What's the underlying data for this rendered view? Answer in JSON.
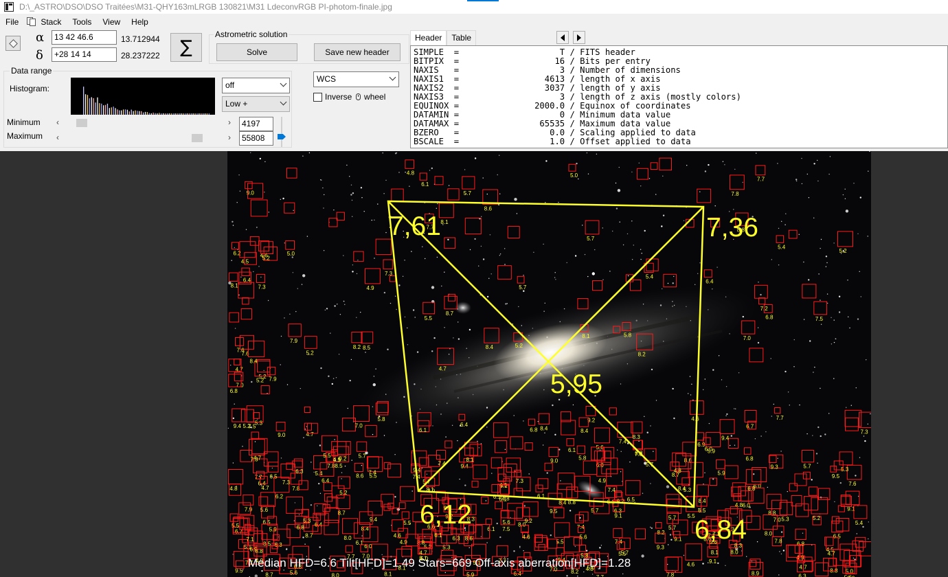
{
  "window": {
    "title": "D:\\_ASTRO\\DSO\\DSO Traitées\\M31-QHY163mLRGB 130821\\M31 LdeconvRGB PI-photom-finale.jpg"
  },
  "menu": {
    "file": "File",
    "stack": "Stack",
    "tools": "Tools",
    "view": "View",
    "help": "Help"
  },
  "coords": {
    "alpha_symbol": "α",
    "alpha_value": "13 42  46.6",
    "alpha_decimal": "13.712944",
    "delta_symbol": "δ",
    "delta_value": "+28 14  14",
    "delta_decimal": "28.237222",
    "sigma_label": "∑"
  },
  "astrometric": {
    "group_label": "Astrometric solution",
    "solve_label": "Solve",
    "save_header_label": "Save new header"
  },
  "data_range": {
    "group_label": "Data range",
    "histogram_label": "Histogram:",
    "stretch_select": "off",
    "range_select": "Low +",
    "minimum_label": "Minimum",
    "maximum_label": "Maximum",
    "minimum_value": "4197",
    "maximum_value": "55808",
    "minimum_fraction": 0.08,
    "maximum_fraction": 0.85
  },
  "wcs": {
    "select_value": "WCS",
    "inverse_label": "Inverse",
    "wheel_label": "wheel",
    "inverse_checked": false
  },
  "header_panel": {
    "tab_header": "Header",
    "tab_table": "Table",
    "fits": [
      "SIMPLE  =                    T / FITS header",
      "BITPIX  =                   16 / Bits per entry",
      "NAXIS   =                    3 / Number of dimensions",
      "NAXIS1  =                 4613 / length of x axis",
      "NAXIS2  =                 3037 / length of y axis",
      "NAXIS3  =                    3 / length of z axis (mostly colors)",
      "EQUINOX =               2000.0 / Equinox of coordinates",
      "DATAMIN =                    0 / Minimum data value",
      "DATAMAX =                65535 / Maximum data value",
      "BZERO   =                  0.0 / Scaling applied to data",
      "BSCALE  =                  1.0 / Offset applied to data"
    ]
  },
  "image": {
    "status_line": "Median HFD=6.6  Tilt[HFD]=1.49  Stars=669  Off-axis aberration[HFD]=1.28",
    "hfd_top_left": "7,61",
    "hfd_top_right": "7,36",
    "hfd_center": "5,95",
    "hfd_bottom_left": "6,12",
    "hfd_bottom_right": "6,84",
    "overlay_color": "#ffff2a",
    "box_color": "#ff1a1a"
  }
}
